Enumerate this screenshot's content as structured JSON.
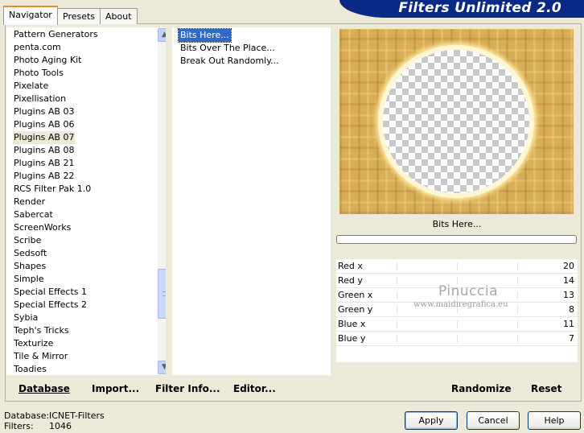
{
  "tabs": [
    "Navigator",
    "Presets",
    "About"
  ],
  "banner_title": "Filters Unlimited 2.0",
  "categories": [
    "Pattern Generators",
    "penta.com",
    "Photo Aging Kit",
    "Photo Tools",
    "Pixelate",
    "Pixellisation",
    "Plugins AB 03",
    "Plugins AB 06",
    "Plugins AB 07",
    "Plugins AB 08",
    "Plugins AB 21",
    "Plugins AB 22",
    "RCS Filter Pak 1.0",
    "Render",
    "Sabercat",
    "ScreenWorks",
    "Scribe",
    "Sedsoft",
    "Shapes",
    "Simple",
    "Special Effects 1",
    "Special Effects 2",
    "Sybia",
    "Teph's Tricks",
    "Texturize",
    "Tile & Mirror",
    "Toadies"
  ],
  "selected_category": "Plugins AB 07",
  "filters": [
    "Bits Here...",
    "Bits Over The Place...",
    "Break Out Randomly..."
  ],
  "selected_filter": "Bits Here...",
  "preview_filter_name": "Bits Here...",
  "params": [
    {
      "label": "Red x",
      "value": "20"
    },
    {
      "label": "Red y",
      "value": "14"
    },
    {
      "label": "Green x",
      "value": "13"
    },
    {
      "label": "Green y",
      "value": "8"
    },
    {
      "label": "Blue x",
      "value": "11"
    },
    {
      "label": "Blue y",
      "value": "7"
    }
  ],
  "watermark": {
    "name": "Pinuccia",
    "url": "www.maidiregrafica.eu"
  },
  "left_buttons": {
    "database": "Database",
    "import": "Import...",
    "filter_info": "Filter Info...",
    "editor": "Editor..."
  },
  "right_buttons": {
    "randomize": "Randomize",
    "reset": "Reset"
  },
  "status": {
    "database_label": "Database:",
    "database_value": "ICNET-Filters",
    "filters_label": "Filters:",
    "filters_value": "1046"
  },
  "dialog_buttons": {
    "apply": "Apply",
    "cancel": "Cancel",
    "help": "Help"
  }
}
